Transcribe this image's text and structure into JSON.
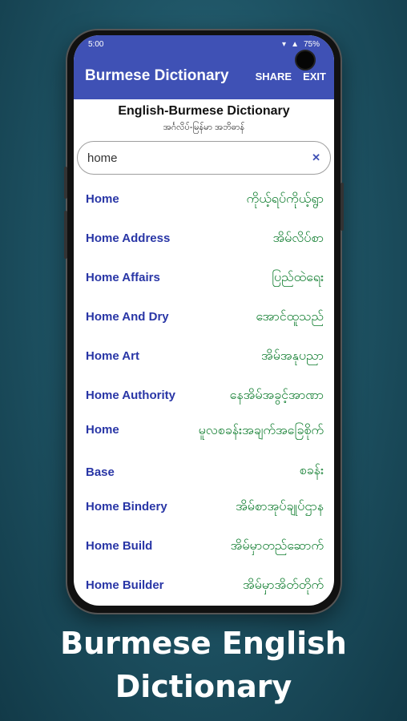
{
  "status": {
    "time": "5:00",
    "battery": "75%"
  },
  "appbar": {
    "title": "Burmese Dictionary",
    "share_label": "SHARE",
    "exit_label": "EXIT"
  },
  "header": {
    "title": "English-Burmese Dictionary",
    "subtitle": "အင်္ဂလိပ်-မြန်မာ အဘိဓာန်"
  },
  "search": {
    "value": "home",
    "clear_icon": "close-icon"
  },
  "results": [
    {
      "en": "Home",
      "my": "ကိုယ့်ရပ်ကိုယ့်ရွာ"
    },
    {
      "en": "Home Address",
      "my": "အိမ်လိပ်စာ"
    },
    {
      "en": "Home Affairs",
      "my": "ပြည်ထဲရေး"
    },
    {
      "en": "Home And Dry",
      "my": "အောင်ထူသည်"
    },
    {
      "en": "Home Art",
      "my": "အိမ်အနုပညာ"
    },
    {
      "en": "Home Authority",
      "my": "နေအိမ်အခွင့်အာဏာ"
    },
    {
      "en_line1": "Home",
      "en_line2": "Base",
      "my_line1": "မူလစခန်းအချက်အခြေစိုက်",
      "my_line2": "စခန်း"
    },
    {
      "en": "Home Bindery",
      "my": "အိမ်စာအုပ်ချုပ်ဌာန"
    },
    {
      "en": "Home Build",
      "my": "အိမ်မှာတည်ဆောက်"
    },
    {
      "en": "Home Builder",
      "my": "အိမ်မှာအိတ်တိုက်"
    }
  ],
  "promo": {
    "line1": "Burmese English",
    "line2": "Dictionary"
  },
  "colors": {
    "primary": "#3f51b5",
    "english": "#2936a6",
    "burmese": "#0a7a2a",
    "background": "#1f5566"
  }
}
